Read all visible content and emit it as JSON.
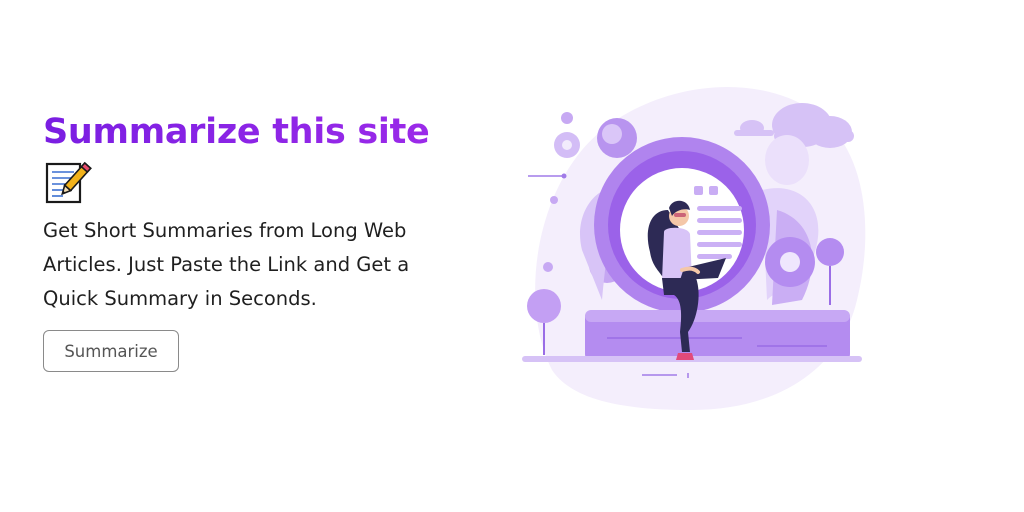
{
  "hero": {
    "title": "Summarize this site",
    "title_icon": "memo-icon",
    "description": "Get Short Summaries from Long Web Articles. Just Paste the Link and Get a Quick Summary in Seconds.",
    "button_label": "Summarize"
  },
  "illustration": {
    "subject": "woman-with-laptop-icon"
  },
  "colors": {
    "accent": "#7c1fe3",
    "title_gradient_end": "#9b26e8",
    "text": "#1f1f1f",
    "button_border": "#8a8a8a",
    "purple_light": "#e9ddfb",
    "purple_mid": "#b48cf0",
    "purple_dark": "#8c52e6"
  }
}
